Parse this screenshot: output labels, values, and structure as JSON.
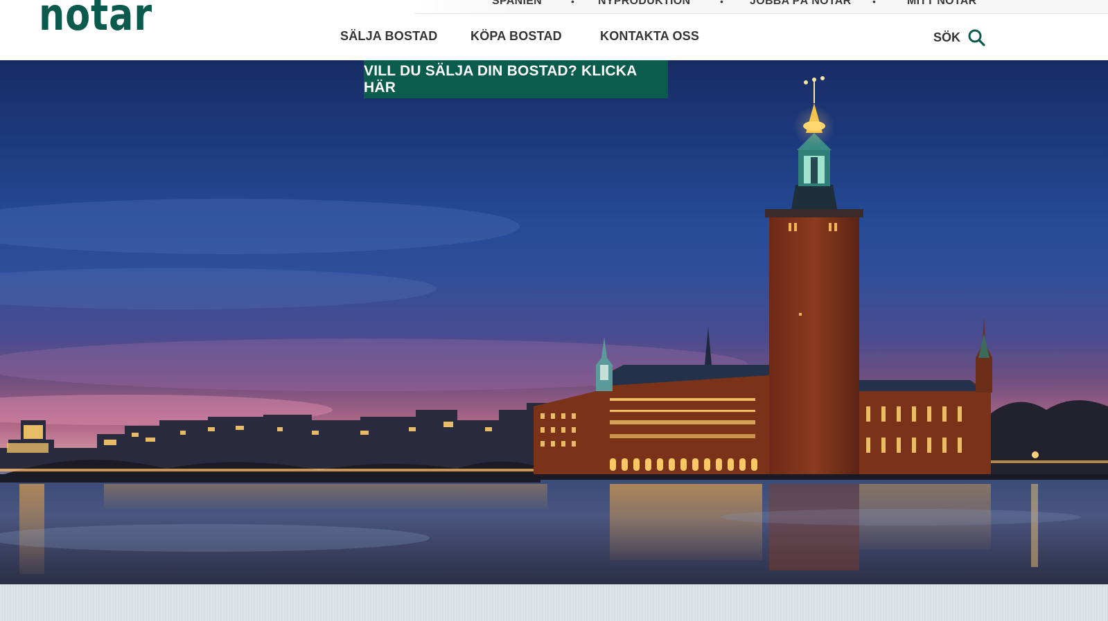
{
  "brand": {
    "logo_text": "notar",
    "color": "#0a5a4e"
  },
  "topbar": {
    "items": [
      "SPANIEN",
      "NYPRODUKTION",
      "JOBBA PÅ NOTAR",
      "MITT NOTAR"
    ],
    "separator": "•"
  },
  "mainnav": {
    "items": [
      "SÄLJA BOSTAD",
      "KÖPA BOSTAD",
      "KONTAKTA OSS"
    ]
  },
  "search": {
    "label": "SÖK",
    "icon": "search-icon"
  },
  "hero": {
    "cta_label": "VILL DU SÄLJA DIN BOSTAD? KLICKA HÄR",
    "cta_color": "#0a5c4c"
  }
}
